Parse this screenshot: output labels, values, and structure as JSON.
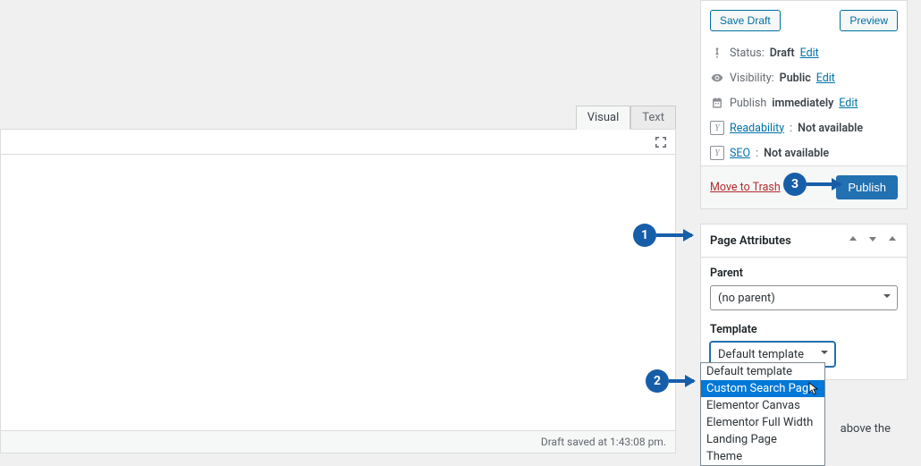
{
  "editor": {
    "tabs": {
      "visual": "Visual",
      "text": "Text"
    },
    "footer_status": "Draft saved at 1:43:08 pm."
  },
  "publish": {
    "save_draft": "Save Draft",
    "preview": "Preview",
    "status_label": "Status:",
    "status_value": "Draft",
    "visibility_label": "Visibility:",
    "visibility_value": "Public",
    "schedule_prefix": "Publish",
    "schedule_value": "immediately",
    "edit": "Edit",
    "readability_label": "Readability",
    "readability_value": "Not available",
    "seo_label": "SEO",
    "seo_value": "Not available",
    "trash": "Move to Trash",
    "publish_btn": "Publish"
  },
  "page_attributes": {
    "title": "Page Attributes",
    "parent_label": "Parent",
    "parent_value": "(no parent)",
    "template_label": "Template",
    "template_value": "Default template",
    "template_options": [
      "Default template",
      "Custom Search Page",
      "Elementor Canvas",
      "Elementor Full Width",
      "Landing Page",
      "Theme"
    ],
    "template_selected_index": 1
  },
  "truncated_text": "above the",
  "callouts": {
    "one": "1",
    "two": "2",
    "three": "3"
  }
}
